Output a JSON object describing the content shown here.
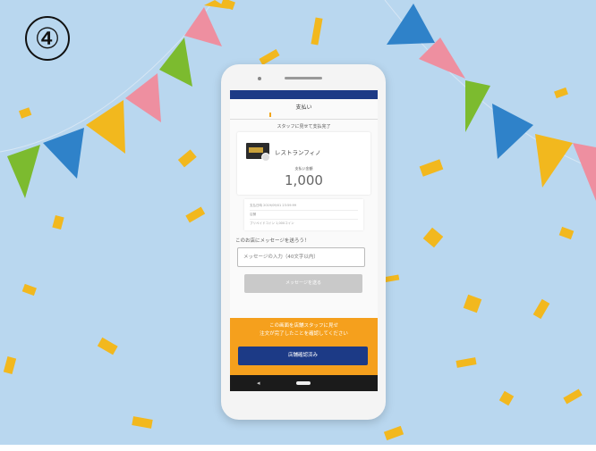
{
  "step_number": "④",
  "app": {
    "header_title": "支払い",
    "status_text": "スタッフに見せて支払完了",
    "shop_name": "レストランフィノ",
    "amount_label": "支払い金額",
    "amount": "1,000",
    "details": [
      "支払日時 2019/09/01 23:59:99",
      "店舗",
      "プリペイドコイン 1,000コイン"
    ],
    "message_prompt": "このお店にメッセージを送ろう！",
    "message_placeholder": "メッセージの入力（40文字以内）",
    "send_button_label": "メッセージを送る",
    "notice_lines": [
      "この画面を店舗スタッフに見せ",
      "注文が完了したことを確認してください"
    ],
    "confirm_button_label": "店舗確認済み",
    "nav_back_icon": "back-triangle-icon",
    "nav_home_icon": "home-pill-icon"
  },
  "colors": {
    "background": "#b9d7ef",
    "header_bar": "#1c3a86",
    "accent_orange": "#f5a01d",
    "send_button_disabled": "#c9c9c9"
  }
}
